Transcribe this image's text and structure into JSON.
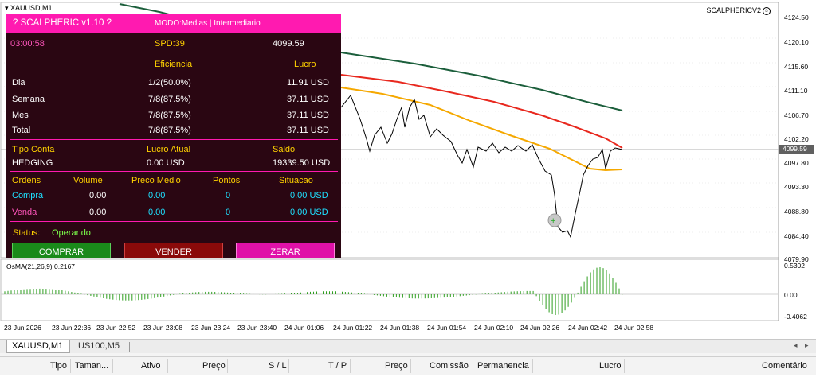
{
  "chart": {
    "symbol_title": "XAUUSD,M1",
    "ea_name": "SCALPHERICV2",
    "smiley": "☺",
    "price_axis": [
      "4124.50",
      "4120.10",
      "4115.60",
      "4111.10",
      "4106.70",
      "4102.20",
      "4097.80",
      "4093.30",
      "4088.80",
      "4084.40",
      "4079.90"
    ],
    "current_price": "4099.59",
    "osma_title": "OsMA(21,26,9) 0.2167",
    "osma_axis": [
      "0.5302",
      "0.00",
      "-0.4062"
    ],
    "time_axis": [
      "23 Jun 2026",
      "23 Jun 22:36",
      "23 Jun 22:52",
      "23 Jun 23:08",
      "23 Jun 23:24",
      "23 Jun 23:40",
      "24 Jun 01:06",
      "24 Jun 01:22",
      "24 Jun 01:38",
      "24 Jun 01:54",
      "24 Jun 02:10",
      "24 Jun 02:26",
      "24 Jun 02:42",
      "24 Jun 02:58"
    ],
    "colors": {
      "ma_slow": "#1b5e3b",
      "ma_mid": "#e8281e",
      "ma_fast": "#f5a800",
      "price_line": "#000000",
      "osma": "#2e9e1f",
      "grid": "#d9d9d9"
    }
  },
  "panel": {
    "title": "? SCALPHERIC v1.10 ?",
    "mode": "MODO:Medias | Intermediario",
    "timer": "03:00:58",
    "spread": "SPD:39",
    "price": "4099.59",
    "col_eficiencia": "Eficiencia",
    "col_lucro": "Lucro",
    "stats": [
      {
        "label": "Dia",
        "eff": "1/2(50.0%)",
        "profit": "11.91 USD"
      },
      {
        "label": "Semana",
        "eff": "7/8(87.5%)",
        "profit": "37.11 USD"
      },
      {
        "label": "Mes",
        "eff": "7/8(87.5%)",
        "profit": "37.11 USD"
      },
      {
        "label": "Total",
        "eff": "7/8(87.5%)",
        "profit": "37.11 USD"
      }
    ],
    "account_headers": {
      "tipo": "Tipo Conta",
      "lucro_atual": "Lucro Atual",
      "saldo": "Saldo"
    },
    "account_values": {
      "tipo": "HEDGING",
      "lucro_atual": "0.00 USD",
      "saldo": "19339.50 USD"
    },
    "orders_headers": {
      "ordens": "Ordens",
      "volume": "Volume",
      "preco": "Preco Medio",
      "pontos": "Pontos",
      "situacao": "Situacao"
    },
    "orders": [
      {
        "label": "Compra",
        "volume": "0.00",
        "preco": "0.00",
        "pontos": "0",
        "situacao": "0.00 USD"
      },
      {
        "label": "Venda",
        "volume": "0.00",
        "preco": "0.00",
        "pontos": "0",
        "situacao": "0.00 USD"
      }
    ],
    "status_label": "Status:",
    "status_value": "Operando",
    "buttons": {
      "buy": "COMPRAR",
      "sell": "VENDER",
      "close": "ZERAR"
    },
    "colors": {
      "bg": "#2a0612",
      "title": "#ff1ab0",
      "buy": "#1a8a1a",
      "sell": "#8a0a0a",
      "close": "#e011a8"
    }
  },
  "tabs": [
    {
      "label": "XAUUSD,M1",
      "active": true
    },
    {
      "label": "US100,M5",
      "active": false
    }
  ],
  "table_headers": [
    "Tipo",
    "Taman...",
    "Ativo",
    "Preço",
    "S / L",
    "T / P",
    "Preço",
    "Comissão",
    "Permanencia",
    "Lucro",
    "Comentário"
  ]
}
